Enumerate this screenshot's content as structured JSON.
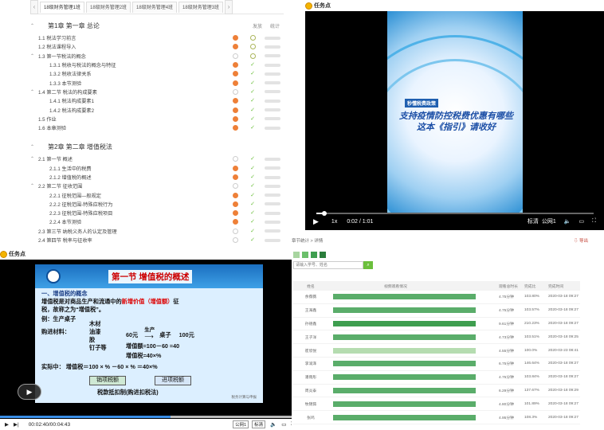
{
  "outline": {
    "tabs": [
      "18级财务管理1班",
      "18级财务管理2班",
      "18级财务管理4班",
      "18级财务管理3班"
    ],
    "columns": {
      "play": "发放",
      "stat": "统计"
    },
    "chapter1": {
      "title": "第1章 第一章 总论",
      "rows": [
        {
          "label": "1.1 税法学习前言",
          "indent": 0,
          "dot": "orange",
          "mark": "ring"
        },
        {
          "label": "1.2 税法课程导入",
          "indent": 0,
          "dot": "orange",
          "mark": "ring"
        },
        {
          "label": "1.3 第一节税法的概念",
          "indent": 0,
          "dot": "gray",
          "mark": "ring",
          "caret": true
        },
        {
          "label": "1.3.1 税收与税法的概念与特征",
          "indent": 1,
          "dot": "orange",
          "mark": "check"
        },
        {
          "label": "1.3.2 税收法律关系",
          "indent": 1,
          "dot": "orange",
          "mark": "check"
        },
        {
          "label": "1.3.3 本节测验",
          "indent": 1,
          "dot": "orange",
          "mark": "check"
        },
        {
          "label": "1.4 第二节 税法的构成要素",
          "indent": 0,
          "dot": "gray",
          "mark": "check",
          "caret": true
        },
        {
          "label": "1.4.1 税法构成要素1",
          "indent": 1,
          "dot": "orange",
          "mark": "check"
        },
        {
          "label": "1.4.2 税法构成要素2",
          "indent": 1,
          "dot": "orange",
          "mark": "check"
        },
        {
          "label": "1.5 作业",
          "indent": 0,
          "dot": "orange",
          "mark": "check"
        },
        {
          "label": "1.6 本章测验",
          "indent": 0,
          "dot": "orange",
          "mark": "check"
        }
      ]
    },
    "chapter2": {
      "title": "第2章 第二章 增值税法",
      "rows": [
        {
          "label": "2.1 第一节 概述",
          "indent": 0,
          "dot": "gray",
          "mark": "check",
          "caret": true
        },
        {
          "label": "2.1.1 生活中的税费",
          "indent": 1,
          "dot": "orange",
          "mark": "check"
        },
        {
          "label": "2.1.2 增值税的概述",
          "indent": 1,
          "dot": "orange",
          "mark": "check"
        },
        {
          "label": "2.2 第二节 征收范围",
          "indent": 0,
          "dot": "gray",
          "mark": "check",
          "caret": true
        },
        {
          "label": "2.2.1 征税范围—般规定",
          "indent": 1,
          "dot": "orange",
          "mark": "check"
        },
        {
          "label": "2.2.2 征税范围-特殊应税行为",
          "indent": 1,
          "dot": "orange",
          "mark": "check"
        },
        {
          "label": "2.2.3 征税范围-特殊应税项目",
          "indent": 1,
          "dot": "orange",
          "mark": "check"
        },
        {
          "label": "2.2.4 本节测验",
          "indent": 1,
          "dot": "orange",
          "mark": "check"
        },
        {
          "label": "2.3 第三节 纳税义务人的认定及管理",
          "indent": 0,
          "dot": "gray",
          "mark": "check"
        },
        {
          "label": "2.4 第四节 税率与征收率",
          "indent": 0,
          "dot": "gray",
          "mark": "check"
        }
      ]
    }
  },
  "video_portrait": {
    "task_label": "任务点",
    "tag": "秒懂税费政策",
    "title_line1": "支持疫情防控税费优惠有哪些",
    "title_line2": "这本《指引》请收好",
    "speed": "1x",
    "time": "0:02 / 1:01",
    "progress": 0.03,
    "quality": "标清",
    "mode": "公网1"
  },
  "video_slide": {
    "task_label": "任务点",
    "slide_title": "第一节 增值税的概述",
    "line1": "一、增值税的概念",
    "line2_a": "增值税是对商品生产和流通中的",
    "line2_b": "新增价值（增值额）",
    "line2_c": "征",
    "line3": "税，故称之为“增值税”。",
    "example": "例：生产桌子",
    "items": [
      "木材",
      "油漆",
      "胶",
      "钉子等"
    ],
    "materials": "购进材料：",
    "cost": "60元",
    "produce": "生产",
    "product": "桌子",
    "price": "100元",
    "added": "增值额=100－60 =40",
    "vat": "增值税=40×%",
    "actual": "实际中：  增值税＝100 × %  －60 × % ＝40×%",
    "box1": "销项税额",
    "box2": "进项税额",
    "deduct": "税款抵扣制(购进扣税法)",
    "footer": "税务计算与申报",
    "time": "00:02:40/00:04:43",
    "progress": 0.566,
    "quality": "公网1",
    "mode": "标清"
  },
  "stats": {
    "crumb": "章节统计 > 详情",
    "export": "导出",
    "search_placeholder": "请输入学号、姓名",
    "headers": {
      "name": "姓名",
      "bar": "视频观看情况",
      "dur": "观看总时长",
      "pct": "完成比",
      "time": "完成时间"
    },
    "swatches": [
      "#a8d5a0",
      "#6bbf6b",
      "#3e9e4f",
      "#2b7d3c"
    ],
    "rows": [
      {
        "name": "余薇薇",
        "fill": 0.86,
        "color": "#5aad6a",
        "dur": "4.75分钟",
        "pct": "103.80%",
        "time": "2020-03-18 09:27"
      },
      {
        "name": "王海鑫",
        "fill": 0.86,
        "color": "#5aad6a",
        "dur": "4.75分钟",
        "pct": "103.57%",
        "time": "2020-03-18 09:27"
      },
      {
        "name": "孙德鑫",
        "fill": 0.86,
        "color": "#3e9e4f",
        "dur": "9.61分钟",
        "pct": "210.23%",
        "time": "2020-03-18 09:27"
      },
      {
        "name": "王子洋",
        "fill": 0.86,
        "color": "#5aad6a",
        "dur": "4.73分钟",
        "pct": "103.51%",
        "time": "2020-03-18 09:25"
      },
      {
        "name": "崔欣悦",
        "fill": 0.86,
        "color": "#b5dcb0",
        "dur": "4.55分钟",
        "pct": "100.0%",
        "time": "2020-03-23 08:41"
      },
      {
        "name": "李润泽",
        "fill": 0.86,
        "color": "#5aad6a",
        "dur": "6.75分钟",
        "pct": "146.64%",
        "time": "2020-03-18 09:27"
      },
      {
        "name": "潘雨彤",
        "fill": 0.86,
        "color": "#5aad6a",
        "dur": "4.75分钟",
        "pct": "103.84%",
        "time": "2020-03-18 09:27"
      },
      {
        "name": "周炎泰",
        "fill": 0.86,
        "color": "#5aad6a",
        "dur": "6.29分钟",
        "pct": "137.67%",
        "time": "2020-03-18 09:29"
      },
      {
        "name": "牧锦茹",
        "fill": 0.86,
        "color": "#5aad6a",
        "dur": "4.80分钟",
        "pct": "101.89%",
        "time": "2020-03-18 09:27"
      },
      {
        "name": "张鸣",
        "fill": 0.86,
        "color": "#5aad6a",
        "dur": "4.95分钟",
        "pct": "108.3%",
        "time": "2020-03-18 09:27"
      }
    ]
  }
}
